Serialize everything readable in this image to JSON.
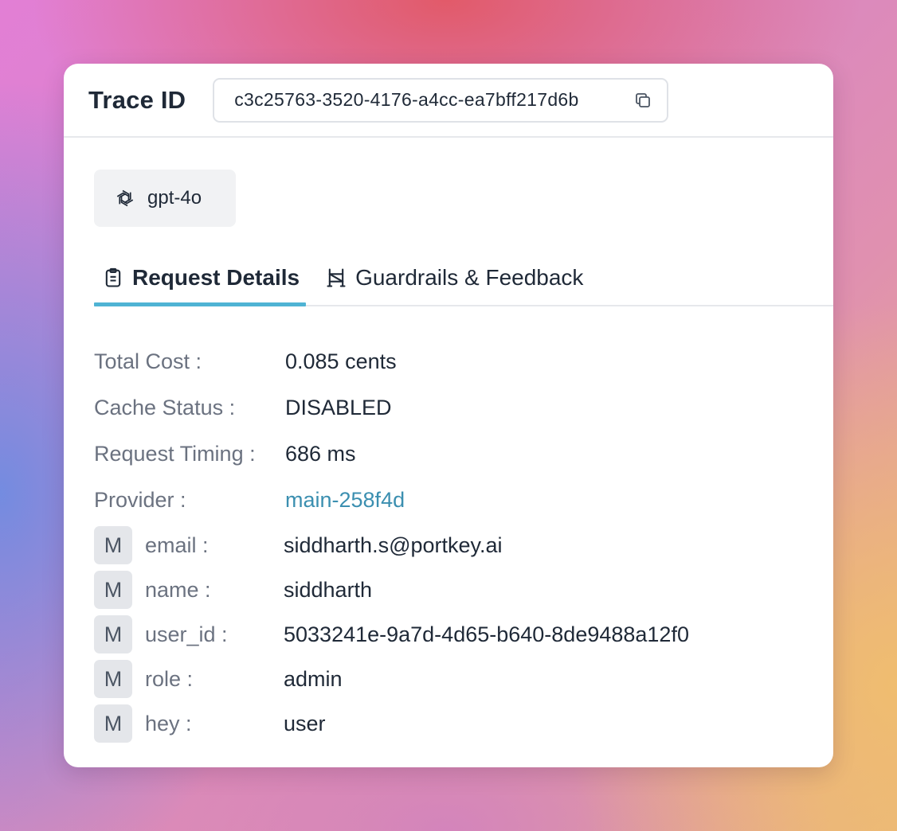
{
  "header": {
    "title": "Trace ID",
    "trace_id": "c3c25763-3520-4176-a4cc-ea7bff217d6b",
    "copy_icon": "copy-icon"
  },
  "model": {
    "name": "gpt-4o",
    "icon": "openai-icon"
  },
  "tabs": [
    {
      "label": "Request Details",
      "icon": "clipboard-icon",
      "active": true
    },
    {
      "label": "Guardrails & Feedback",
      "icon": "guardrail-icon",
      "active": false
    }
  ],
  "details": [
    {
      "label": "Total Cost :",
      "value": "0.085 cents"
    },
    {
      "label": "Cache Status :",
      "value": "DISABLED"
    },
    {
      "label": "Request Timing :",
      "value": "686 ms"
    },
    {
      "label": "Provider :",
      "value": "main-258f4d"
    }
  ],
  "metadata": [
    {
      "badge": "M",
      "key": "email :",
      "value": "siddharth.s@portkey.ai"
    },
    {
      "badge": "M",
      "key": "name :",
      "value": "siddharth"
    },
    {
      "badge": "M",
      "key": "user_id :",
      "value": "5033241e-9a7d-4d65-b640-8de9488a12f0"
    },
    {
      "badge": "M",
      "key": "role :",
      "value": "admin"
    },
    {
      "badge": "M",
      "key": "hey :",
      "value": "user"
    }
  ],
  "colors": {
    "accent": "#4fb3d4",
    "link": "#3b8fb0"
  }
}
